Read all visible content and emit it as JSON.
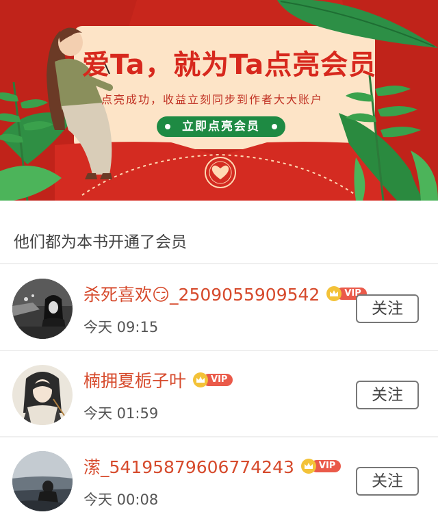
{
  "banner": {
    "title": "爱Ta，就为Ta点亮会员",
    "subtitle": "点亮成功，收益立刻同步到作者大大账户",
    "cta_label": "立即点亮会员"
  },
  "section_title": "他们都为本书开通了会员",
  "members": [
    {
      "username": "杀死喜欢😏_2509055909542",
      "time": "今天 09:15",
      "vip_label": "VIP",
      "follow_label": "关注"
    },
    {
      "username": "楠拥夏栀子叶",
      "time": "今天 01:59",
      "vip_label": "VIP",
      "follow_label": "关注"
    },
    {
      "username": "潆_54195879606774243",
      "time": "今天 00:08",
      "vip_label": "VIP",
      "follow_label": "关注"
    }
  ],
  "colors": {
    "banner_red": "#c8261c",
    "cta_green": "#1e8a43",
    "username": "#d64a2c",
    "vip_pill": "#ea5a4a",
    "crown": "#f3c238"
  },
  "icons": [
    "heart-seal-icon",
    "crown-icon"
  ]
}
